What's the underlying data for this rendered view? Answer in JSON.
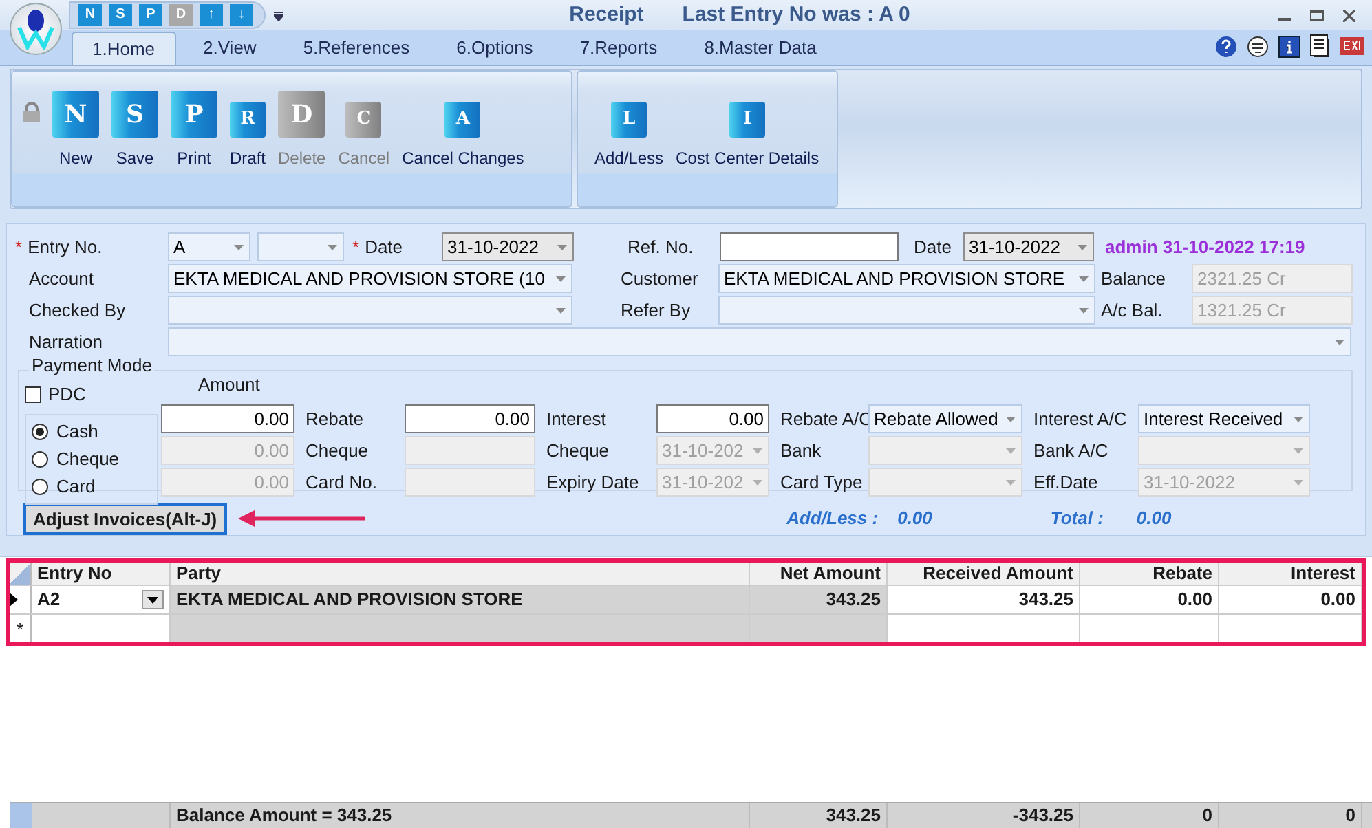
{
  "window": {
    "title": "Receipt",
    "subtitle": "Last Entry No was : A 0"
  },
  "quick_access": [
    {
      "glyph": "N",
      "disabled": false
    },
    {
      "glyph": "S",
      "disabled": false
    },
    {
      "glyph": "P",
      "disabled": false
    },
    {
      "glyph": "D",
      "disabled": true
    },
    {
      "glyph": "↑",
      "disabled": false
    },
    {
      "glyph": "↓",
      "disabled": false
    }
  ],
  "tabs": [
    {
      "label": "1.Home",
      "selected": true
    },
    {
      "label": "2.View",
      "selected": false
    },
    {
      "label": "5.References",
      "selected": false
    },
    {
      "label": "6.Options",
      "selected": false
    },
    {
      "label": "7.Reports",
      "selected": false
    },
    {
      "label": "8.Master Data",
      "selected": false
    }
  ],
  "ribbon_groups": [
    {
      "buttons": [
        {
          "label": "New",
          "glyph": "N",
          "disabled": false,
          "kind": "large"
        },
        {
          "label": "Save",
          "glyph": "S",
          "disabled": false,
          "kind": "large"
        },
        {
          "label": "Print",
          "glyph": "P",
          "disabled": false,
          "kind": "large"
        },
        {
          "label": "Draft",
          "glyph": "R",
          "disabled": false,
          "kind": "small"
        },
        {
          "label": "Delete",
          "glyph": "D",
          "disabled": true,
          "kind": "large"
        },
        {
          "label": "Cancel",
          "glyph": "C",
          "disabled": true,
          "kind": "small"
        },
        {
          "label": "Cancel Changes",
          "glyph": "A",
          "disabled": false,
          "kind": "small"
        }
      ]
    },
    {
      "buttons": [
        {
          "label": "Add/Less",
          "glyph": "L",
          "disabled": false,
          "kind": "small"
        },
        {
          "label": "Cost Center Details",
          "glyph": "I",
          "disabled": false,
          "kind": "small"
        }
      ]
    }
  ],
  "header": {
    "entry_no_label": "Entry No.",
    "entry_no": "A",
    "date_label": "Date",
    "date": "31-10-2022",
    "ref_no_label": "Ref. No.",
    "ref_date_label": "Date",
    "ref_date": "31-10-2022",
    "audit": "admin 31-10-2022 17:19",
    "account_label": "Account",
    "account": "EKTA MEDICAL AND PROVISION STORE (10",
    "customer_label": "Customer",
    "customer": "EKTA MEDICAL AND PROVISION STORE",
    "balance_label": "Balance",
    "balance": "2321.25 Cr",
    "checked_by_label": "Checked By",
    "refer_by_label": "Refer By",
    "ac_bal_label": "A/c Bal.",
    "ac_bal": "1321.25 Cr",
    "narration_label": "Narration",
    "required_mark": "*"
  },
  "payment": {
    "legend": "Payment Mode",
    "pdc": {
      "label": "PDC",
      "checked": false
    },
    "amount_label": "Amount",
    "modes": [
      {
        "label": "Cash",
        "selected": true
      },
      {
        "label": "Cheque",
        "selected": false
      },
      {
        "label": "Card",
        "selected": false
      }
    ],
    "rows": [
      [
        {
          "kind": "number",
          "value": "0.00",
          "disabled": false
        },
        {
          "kind": "label",
          "text": "Rebate"
        },
        {
          "kind": "number",
          "value": "0.00",
          "disabled": false
        },
        {
          "kind": "label",
          "text": "Interest"
        },
        {
          "kind": "number",
          "value": "0.00",
          "disabled": false
        },
        {
          "kind": "label",
          "text": "Rebate A/C"
        },
        {
          "kind": "combo",
          "value": "Rebate Allowed",
          "disabled": false
        },
        {
          "kind": "label",
          "text": "Interest A/C"
        },
        {
          "kind": "combo",
          "value": "Interest Received",
          "disabled": false
        }
      ],
      [
        {
          "kind": "number",
          "value": "0.00",
          "disabled": true
        },
        {
          "kind": "label",
          "text": "Cheque"
        },
        {
          "kind": "number",
          "disabled": true
        },
        {
          "kind": "label",
          "text": "Cheque"
        },
        {
          "kind": "combo",
          "value": "31-10-202",
          "disabled": true
        },
        {
          "kind": "label",
          "text": "Bank"
        },
        {
          "kind": "combo",
          "disabled": true
        },
        {
          "kind": "label",
          "text": "Bank A/C"
        },
        {
          "kind": "combo",
          "disabled": true
        }
      ],
      [
        {
          "kind": "number",
          "value": "0.00",
          "disabled": true
        },
        {
          "kind": "label",
          "text": "Card No."
        },
        {
          "kind": "number",
          "disabled": true
        },
        {
          "kind": "label",
          "text": "Expiry Date"
        },
        {
          "kind": "combo",
          "value": "31-10-202",
          "disabled": true
        },
        {
          "kind": "label",
          "text": "Card Type"
        },
        {
          "kind": "combo",
          "disabled": true
        },
        {
          "kind": "label",
          "text": "Eff.Date"
        },
        {
          "kind": "combo",
          "value": "31-10-2022",
          "disabled": true
        }
      ]
    ]
  },
  "adjust_button": "Adjust Invoices(Alt-J)",
  "summary": {
    "add_less_label": "Add/Less :",
    "add_less": "0.00",
    "total_label": "Total :",
    "total": "0.00"
  },
  "table": {
    "columns": [
      "Entry No",
      "Party",
      "Net Amount",
      "Received Amount",
      "Rebate",
      "Interest"
    ],
    "rows": [
      {
        "cells": [
          "A2",
          "EKTA MEDICAL AND PROVISION STORE",
          "343.25",
          "343.25",
          "0.00",
          "0.00"
        ],
        "selected": true
      }
    ],
    "new_row_mark": "*",
    "footer": [
      "Balance Amount = 343.25",
      "343.25",
      "-343.25",
      "0",
      "0"
    ]
  }
}
